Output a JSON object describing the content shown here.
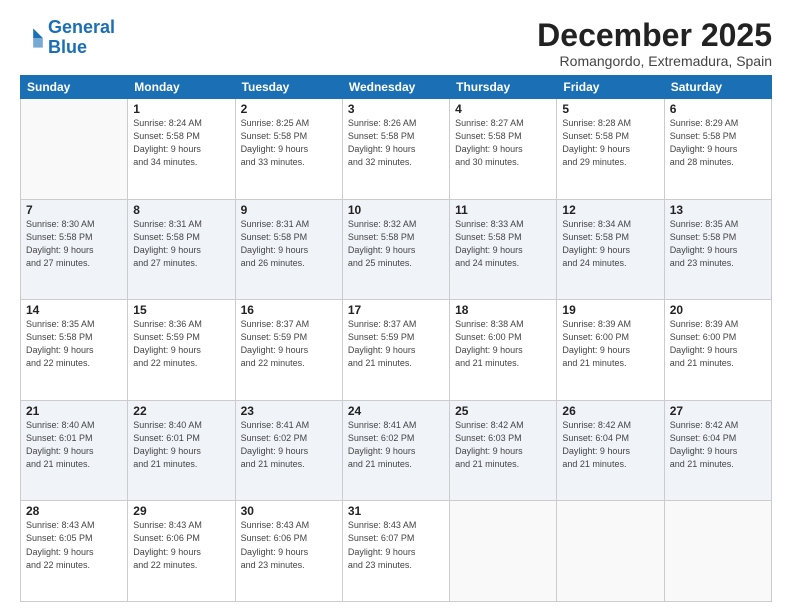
{
  "logo": {
    "line1": "General",
    "line2": "Blue"
  },
  "title": "December 2025",
  "subtitle": "Romangordo, Extremadura, Spain",
  "days_of_week": [
    "Sunday",
    "Monday",
    "Tuesday",
    "Wednesday",
    "Thursday",
    "Friday",
    "Saturday"
  ],
  "weeks": [
    [
      {
        "day": "",
        "info": ""
      },
      {
        "day": "1",
        "info": "Sunrise: 8:24 AM\nSunset: 5:58 PM\nDaylight: 9 hours\nand 34 minutes."
      },
      {
        "day": "2",
        "info": "Sunrise: 8:25 AM\nSunset: 5:58 PM\nDaylight: 9 hours\nand 33 minutes."
      },
      {
        "day": "3",
        "info": "Sunrise: 8:26 AM\nSunset: 5:58 PM\nDaylight: 9 hours\nand 32 minutes."
      },
      {
        "day": "4",
        "info": "Sunrise: 8:27 AM\nSunset: 5:58 PM\nDaylight: 9 hours\nand 30 minutes."
      },
      {
        "day": "5",
        "info": "Sunrise: 8:28 AM\nSunset: 5:58 PM\nDaylight: 9 hours\nand 29 minutes."
      },
      {
        "day": "6",
        "info": "Sunrise: 8:29 AM\nSunset: 5:58 PM\nDaylight: 9 hours\nand 28 minutes."
      }
    ],
    [
      {
        "day": "7",
        "info": "Sunrise: 8:30 AM\nSunset: 5:58 PM\nDaylight: 9 hours\nand 27 minutes."
      },
      {
        "day": "8",
        "info": "Sunrise: 8:31 AM\nSunset: 5:58 PM\nDaylight: 9 hours\nand 27 minutes."
      },
      {
        "day": "9",
        "info": "Sunrise: 8:31 AM\nSunset: 5:58 PM\nDaylight: 9 hours\nand 26 minutes."
      },
      {
        "day": "10",
        "info": "Sunrise: 8:32 AM\nSunset: 5:58 PM\nDaylight: 9 hours\nand 25 minutes."
      },
      {
        "day": "11",
        "info": "Sunrise: 8:33 AM\nSunset: 5:58 PM\nDaylight: 9 hours\nand 24 minutes."
      },
      {
        "day": "12",
        "info": "Sunrise: 8:34 AM\nSunset: 5:58 PM\nDaylight: 9 hours\nand 24 minutes."
      },
      {
        "day": "13",
        "info": "Sunrise: 8:35 AM\nSunset: 5:58 PM\nDaylight: 9 hours\nand 23 minutes."
      }
    ],
    [
      {
        "day": "14",
        "info": "Sunrise: 8:35 AM\nSunset: 5:58 PM\nDaylight: 9 hours\nand 22 minutes."
      },
      {
        "day": "15",
        "info": "Sunrise: 8:36 AM\nSunset: 5:59 PM\nDaylight: 9 hours\nand 22 minutes."
      },
      {
        "day": "16",
        "info": "Sunrise: 8:37 AM\nSunset: 5:59 PM\nDaylight: 9 hours\nand 22 minutes."
      },
      {
        "day": "17",
        "info": "Sunrise: 8:37 AM\nSunset: 5:59 PM\nDaylight: 9 hours\nand 21 minutes."
      },
      {
        "day": "18",
        "info": "Sunrise: 8:38 AM\nSunset: 6:00 PM\nDaylight: 9 hours\nand 21 minutes."
      },
      {
        "day": "19",
        "info": "Sunrise: 8:39 AM\nSunset: 6:00 PM\nDaylight: 9 hours\nand 21 minutes."
      },
      {
        "day": "20",
        "info": "Sunrise: 8:39 AM\nSunset: 6:00 PM\nDaylight: 9 hours\nand 21 minutes."
      }
    ],
    [
      {
        "day": "21",
        "info": "Sunrise: 8:40 AM\nSunset: 6:01 PM\nDaylight: 9 hours\nand 21 minutes."
      },
      {
        "day": "22",
        "info": "Sunrise: 8:40 AM\nSunset: 6:01 PM\nDaylight: 9 hours\nand 21 minutes."
      },
      {
        "day": "23",
        "info": "Sunrise: 8:41 AM\nSunset: 6:02 PM\nDaylight: 9 hours\nand 21 minutes."
      },
      {
        "day": "24",
        "info": "Sunrise: 8:41 AM\nSunset: 6:02 PM\nDaylight: 9 hours\nand 21 minutes."
      },
      {
        "day": "25",
        "info": "Sunrise: 8:42 AM\nSunset: 6:03 PM\nDaylight: 9 hours\nand 21 minutes."
      },
      {
        "day": "26",
        "info": "Sunrise: 8:42 AM\nSunset: 6:04 PM\nDaylight: 9 hours\nand 21 minutes."
      },
      {
        "day": "27",
        "info": "Sunrise: 8:42 AM\nSunset: 6:04 PM\nDaylight: 9 hours\nand 21 minutes."
      }
    ],
    [
      {
        "day": "28",
        "info": "Sunrise: 8:43 AM\nSunset: 6:05 PM\nDaylight: 9 hours\nand 22 minutes."
      },
      {
        "day": "29",
        "info": "Sunrise: 8:43 AM\nSunset: 6:06 PM\nDaylight: 9 hours\nand 22 minutes."
      },
      {
        "day": "30",
        "info": "Sunrise: 8:43 AM\nSunset: 6:06 PM\nDaylight: 9 hours\nand 23 minutes."
      },
      {
        "day": "31",
        "info": "Sunrise: 8:43 AM\nSunset: 6:07 PM\nDaylight: 9 hours\nand 23 minutes."
      },
      {
        "day": "",
        "info": ""
      },
      {
        "day": "",
        "info": ""
      },
      {
        "day": "",
        "info": ""
      }
    ]
  ]
}
